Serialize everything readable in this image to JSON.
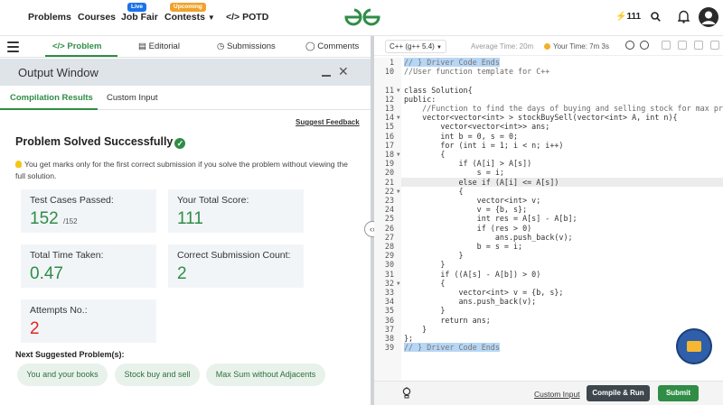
{
  "nav": {
    "problems": "Problems",
    "courses": "Courses",
    "job_fair": "Job Fair",
    "job_fair_badge": "Live",
    "contests": "Contests",
    "contests_badge": "Upcoming",
    "potd": "POTD",
    "streak": "111"
  },
  "problem_tabs": [
    "Problem",
    "Editorial",
    "Submissions",
    "Comments"
  ],
  "output_window": {
    "title": "Output Window",
    "tabs": [
      "Compilation Results",
      "Custom Input"
    ],
    "suggest_feedback": "Suggest Feedback",
    "status": "Problem Solved Successfully",
    "note": "You get marks only for the first correct submission if you solve the problem without viewing the full solution."
  },
  "stats": {
    "test_cases_label": "Test Cases Passed:",
    "test_cases_value": "152",
    "test_cases_total": "/152",
    "score_label": "Your Total Score:",
    "score_value": "111",
    "time_label": "Total Time Taken:",
    "time_value": "0.47",
    "correct_label": "Correct Submission Count:",
    "correct_value": "2",
    "attempts_label": "Attempts No.:",
    "attempts_value": "2"
  },
  "next_problems": {
    "title": "Next Suggested Problem(s):",
    "items": [
      "You and your books",
      "Stock buy and sell",
      "Max Sum without Adjacents"
    ]
  },
  "editor": {
    "language": "C++ (g++ 5.4)",
    "avg_time": "Average Time: 20m",
    "your_time": "Your Time: 7m 3s",
    "custom_input": "Custom Input",
    "compile_run": "Compile & Run",
    "submit": "Submit"
  },
  "code_lines": [
    {
      "n": "1",
      "t": "// } Driver Code Ends"
    },
    {
      "n": "10",
      "t": "//User function template for C++"
    },
    {
      "n": "",
      "t": ""
    },
    {
      "n": "11",
      "t": "class Solution{"
    },
    {
      "n": "12",
      "t": "public:"
    },
    {
      "n": "13",
      "t": "    //Function to find the days of buying and selling stock for max profit."
    },
    {
      "n": "14",
      "t": "    vector<vector<int> > stockBuySell(vector<int> A, int n){"
    },
    {
      "n": "15",
      "t": "        vector<vector<int>> ans;"
    },
    {
      "n": "16",
      "t": "        int b = 0, s = 0;"
    },
    {
      "n": "17",
      "t": "        for (int i = 1; i < n; i++)"
    },
    {
      "n": "18",
      "t": "        {"
    },
    {
      "n": "19",
      "t": "            if (A[i] > A[s])"
    },
    {
      "n": "20",
      "t": "                s = i;"
    },
    {
      "n": "21",
      "t": "            else if (A[i] <= A[s])"
    },
    {
      "n": "22",
      "t": "            {"
    },
    {
      "n": "23",
      "t": "                vector<int> v;"
    },
    {
      "n": "24",
      "t": "                v = {b, s};"
    },
    {
      "n": "25",
      "t": "                int res = A[s] - A[b];"
    },
    {
      "n": "26",
      "t": "                if (res > 0)"
    },
    {
      "n": "27",
      "t": "                    ans.push_back(v);"
    },
    {
      "n": "28",
      "t": "                b = s = i;"
    },
    {
      "n": "29",
      "t": "            }"
    },
    {
      "n": "30",
      "t": "        }"
    },
    {
      "n": "31",
      "t": "        if ((A[s] - A[b]) > 0)"
    },
    {
      "n": "32",
      "t": "        {"
    },
    {
      "n": "33",
      "t": "            vector<int> v = {b, s};"
    },
    {
      "n": "34",
      "t": "            ans.push_back(v);"
    },
    {
      "n": "35",
      "t": "        }"
    },
    {
      "n": "36",
      "t": "        return ans;"
    },
    {
      "n": "37",
      "t": "    }"
    },
    {
      "n": "38",
      "t": "};"
    },
    {
      "n": "39",
      "t": "// } Driver Code Ends"
    }
  ]
}
